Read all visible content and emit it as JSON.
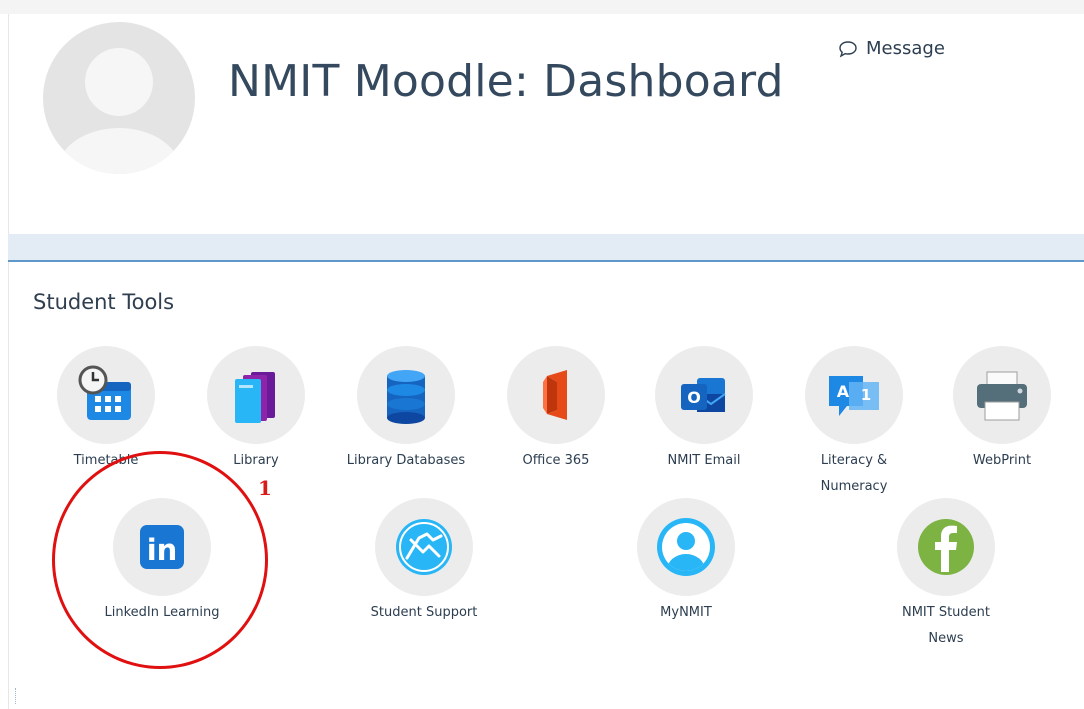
{
  "header": {
    "title": "NMIT Moodle: Dashboard",
    "message_label": "Message"
  },
  "student_tools": {
    "heading": "Student Tools",
    "tools": [
      {
        "label": "Timetable",
        "icon": "timetable-icon"
      },
      {
        "label": "Library",
        "icon": "library-books-icon"
      },
      {
        "label": "Library Databases",
        "icon": "database-icon"
      },
      {
        "label": "Office 365",
        "icon": "office-365-icon"
      },
      {
        "label": "NMIT Email",
        "icon": "outlook-email-icon"
      },
      {
        "label": "Literacy & Numeracy",
        "icon": "literacy-numeracy-icon"
      },
      {
        "label": "WebPrint",
        "icon": "printer-icon"
      },
      {
        "label": "LinkedIn Learning",
        "icon": "linkedin-icon"
      },
      {
        "label": "Student Support",
        "icon": "handshake-icon"
      },
      {
        "label": "MyNMIT",
        "icon": "user-profile-icon"
      },
      {
        "label": "NMIT Student News",
        "icon": "facebook-icon"
      }
    ]
  },
  "annotation": {
    "number": "1",
    "color": "#e01010"
  },
  "colors": {
    "accent_line": "#5e97c8",
    "band": "#e3ecf4",
    "icon_bg": "#ececec"
  }
}
